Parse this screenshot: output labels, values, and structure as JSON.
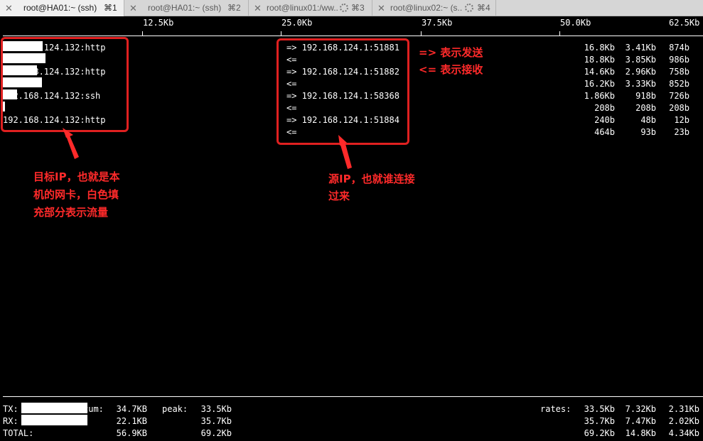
{
  "tabs": [
    {
      "title": "root@HA01:~ (ssh)",
      "shortcut": "⌘1",
      "active": true,
      "loading": false
    },
    {
      "title": "root@HA01:~ (ssh)",
      "shortcut": "⌘2",
      "active": false,
      "loading": false
    },
    {
      "title": "root@linux01:/ww...",
      "shortcut": "⌘3",
      "active": false,
      "loading": true
    },
    {
      "title": "root@linux02:~ (s...",
      "shortcut": "⌘4",
      "active": false,
      "loading": true
    }
  ],
  "scale": [
    "12.5Kb",
    "25.0Kb",
    "37.5Kb",
    "50.0Kb",
    "62.5Kb"
  ],
  "connections": [
    {
      "local": "192.168.124.132:http",
      "sent": {
        "remote": "=> 192.168.124.1:51881",
        "r2": "16.8Kb",
        "r10": "3.41Kb",
        "r40": "874b"
      },
      "recv": {
        "remote": "<=",
        "r2": "18.8Kb",
        "r10": "3.85Kb",
        "r40": "986b"
      }
    },
    {
      "local": "192.168.124.132:http",
      "sent": {
        "remote": "=> 192.168.124.1:51882",
        "r2": "14.6Kb",
        "r10": "2.96Kb",
        "r40": "758b"
      },
      "recv": {
        "remote": "<=",
        "r2": "16.2Kb",
        "r10": "3.33Kb",
        "r40": "852b"
      }
    },
    {
      "local": "192.168.124.132:ssh",
      "sent": {
        "remote": "=> 192.168.124.1:58368",
        "r2": "1.86Kb",
        "r10": "918b",
        "r40": "726b"
      },
      "recv": {
        "remote": "<=",
        "r2": "208b",
        "r10": "208b",
        "r40": "208b"
      }
    },
    {
      "local": "192.168.124.132:http",
      "sent": {
        "remote": "=> 192.168.124.1:51884",
        "r2": "240b",
        "r10": "48b",
        "r40": "12b"
      },
      "recv": {
        "remote": "<=",
        "r2": "464b",
        "r10": "93b",
        "r40": "23b"
      }
    }
  ],
  "totals": {
    "labels": {
      "tx": "TX:",
      "rx": "RX:",
      "total": "TOTAL:",
      "cum": "cum:",
      "peak": "peak:",
      "rates": "rates:"
    },
    "tx": {
      "cum": "34.7KB",
      "peak": "33.5Kb",
      "r2": "33.5Kb",
      "r10": "7.32Kb",
      "r40": "2.31Kb"
    },
    "rx": {
      "cum": "22.1KB",
      "peak": "35.7Kb",
      "r2": "35.7Kb",
      "r10": "7.47Kb",
      "r40": "2.02Kb"
    },
    "total": {
      "cum": "56.9KB",
      "peak": "69.2Kb",
      "r2": "69.2Kb",
      "r10": "14.8Kb",
      "r40": "4.34Kb"
    }
  },
  "annotations": {
    "send_label": "=> 表示发送",
    "recv_label": "<= 表示接收",
    "target_ip_note": [
      "目标IP，也就是本",
      "机的网卡，白色填",
      "充部分表示流量"
    ],
    "source_ip_note": [
      "源IP，也就谁连接",
      "过来"
    ]
  },
  "colors": {
    "terminal_bg": "#000000",
    "terminal_fg": "#ffffff",
    "annotation": "#e02020",
    "tabbar": "#d6d6d6"
  }
}
